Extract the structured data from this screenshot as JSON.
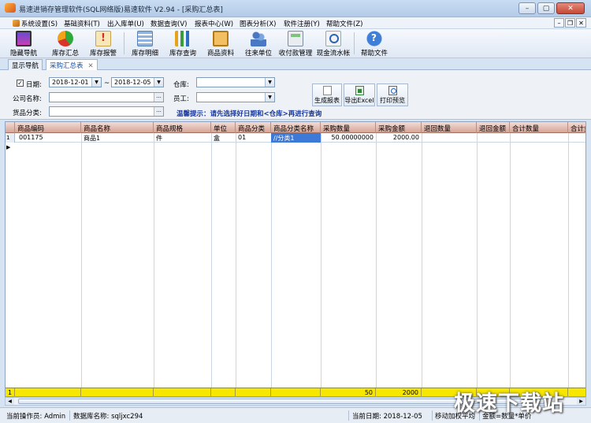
{
  "window": {
    "title": "易速进销存管理软件(SQL网络版)易速软件 V2.94 - [采购汇总表]",
    "minimize_glyph": "–",
    "maximize_glyph": "▢",
    "close_glyph": "✕",
    "mdi_minimize": "–",
    "mdi_restore": "❐",
    "mdi_close": "✕"
  },
  "menu": [
    "系统设置(S)",
    "基础资料(T)",
    "出入库单(U)",
    "数据查询(V)",
    "报表中心(W)",
    "图表分析(X)",
    "软件注册(Y)",
    "帮助文件(Z)"
  ],
  "toolbar": [
    {
      "label": "隐藏导航",
      "icon": "monitor-icon"
    },
    {
      "label": "库存汇总",
      "icon": "pie-chart-icon"
    },
    {
      "label": "库存报警",
      "icon": "warning-icon"
    },
    {
      "label": "库存明细",
      "icon": "grid-icon"
    },
    {
      "label": "库存查询",
      "icon": "bar-chart-icon"
    },
    {
      "label": "商品资料",
      "icon": "box-icon"
    },
    {
      "label": "往来单位",
      "icon": "people-icon"
    },
    {
      "label": "收付款管理",
      "icon": "calculator-icon"
    },
    {
      "label": "现金流水帐",
      "icon": "search-doc-icon"
    },
    {
      "label": "帮助文件",
      "icon": "help-icon"
    }
  ],
  "tabs": {
    "nav": "显示导航",
    "active": "采购汇总表",
    "close": "✕"
  },
  "filter": {
    "date_checked": "✓",
    "date_label": "日期:",
    "date_from": "2018-12-01",
    "date_sep": "~",
    "date_to": "2018-12-05",
    "warehouse_label": "仓库:",
    "warehouse_value": "",
    "company_label": "公司名称:",
    "company_value": "",
    "employee_label": "员工:",
    "employee_value": "",
    "category_label": "货品分类:",
    "category_value": "",
    "btn_generate": "生成报表",
    "btn_export": "导出Excel",
    "btn_print": "打印预览",
    "hint": "温馨提示：请先选择好日期和<仓库>再进行查询",
    "dropdown_glyph": "▼",
    "browse_glyph": "..."
  },
  "table": {
    "columns": [
      "商品编码",
      "商品名称",
      "商品规格",
      "单位",
      "商品分类",
      "商品分类名称",
      "采购数量",
      "采购金额",
      "退回数量",
      "退回金额",
      "合计数量",
      "合计金"
    ],
    "row_indicator": "1 ▶",
    "rows": [
      [
        "001175",
        "商品1",
        "件",
        "盒",
        "01",
        "//分类1",
        "50.00000000",
        "2000.00",
        "",
        "",
        "",
        ""
      ]
    ],
    "total_indicator": "1",
    "totals": {
      "qty": "50",
      "amount": "2000"
    }
  },
  "scroll": {
    "left": "◀",
    "right": "▶"
  },
  "status": {
    "operator": "当前操作员: Admin",
    "db": "数据库名称: sqljxc294",
    "date": "当前日期: 2018-12-05",
    "method": "移动加权平均",
    "formula": "金额=数量*单价"
  },
  "watermark": "极速下载站"
}
